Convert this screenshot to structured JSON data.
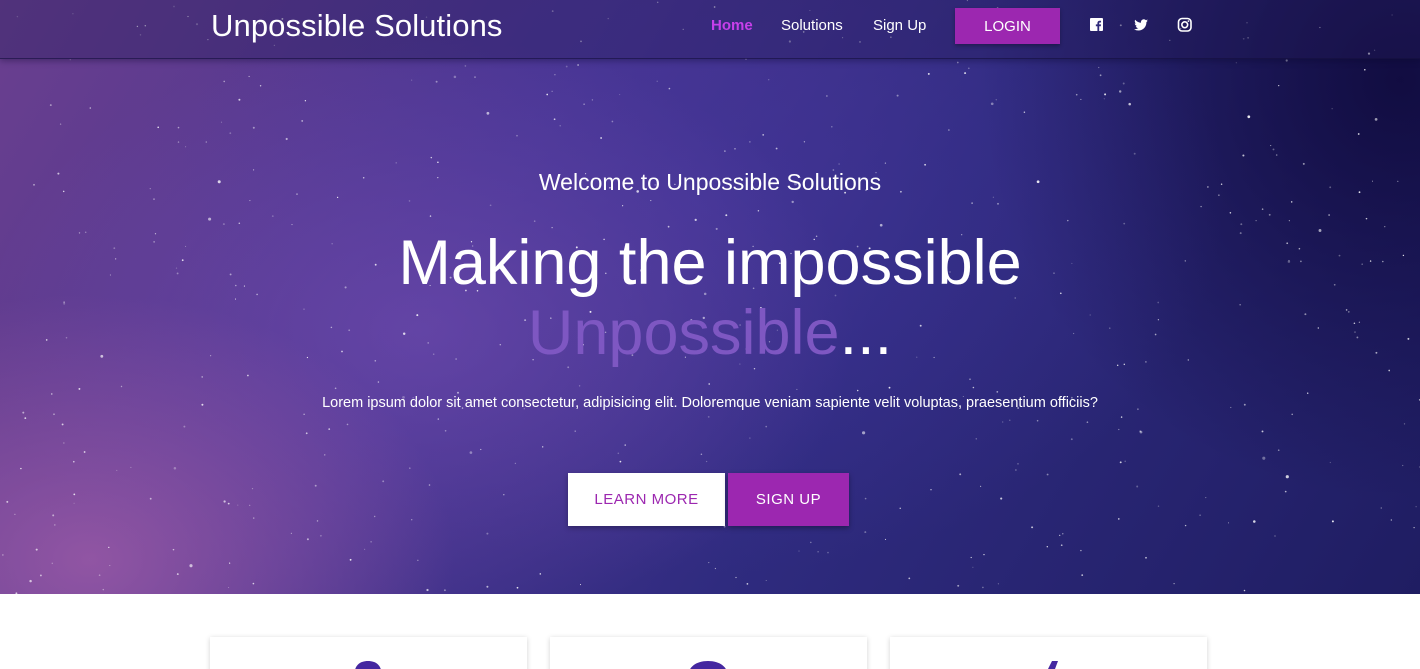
{
  "header": {
    "brand": "Unpossible Solutions",
    "nav": [
      {
        "label": "Home",
        "active": true
      },
      {
        "label": "Solutions",
        "active": false
      },
      {
        "label": "Sign Up",
        "active": false
      }
    ],
    "login_label": "LOGIN",
    "social_icons": [
      "facebook-icon",
      "twitter-icon",
      "instagram-icon"
    ]
  },
  "hero": {
    "welcome": "Welcome to Unpossible Solutions",
    "headline_line1": "Making the impossible",
    "headline_accent": "Unpossible",
    "headline_suffix": "...",
    "lead": "Lorem ipsum dolor sit amet consectetur, adipisicing elit. Doloremque veniam sapiente velit voluptas, praesentium officiis?",
    "learn_more_label": "LEARN MORE",
    "sign_up_label": "SIGN UP"
  },
  "colors": {
    "accent": "#9c27b0",
    "active_nav": "#c73fea",
    "headline_accent": "#7e57c2",
    "card_icon": "#4527a0"
  },
  "cards": [
    {
      "icon": "feature-icon"
    },
    {
      "icon": "feature-icon"
    },
    {
      "icon": "feature-icon"
    }
  ]
}
